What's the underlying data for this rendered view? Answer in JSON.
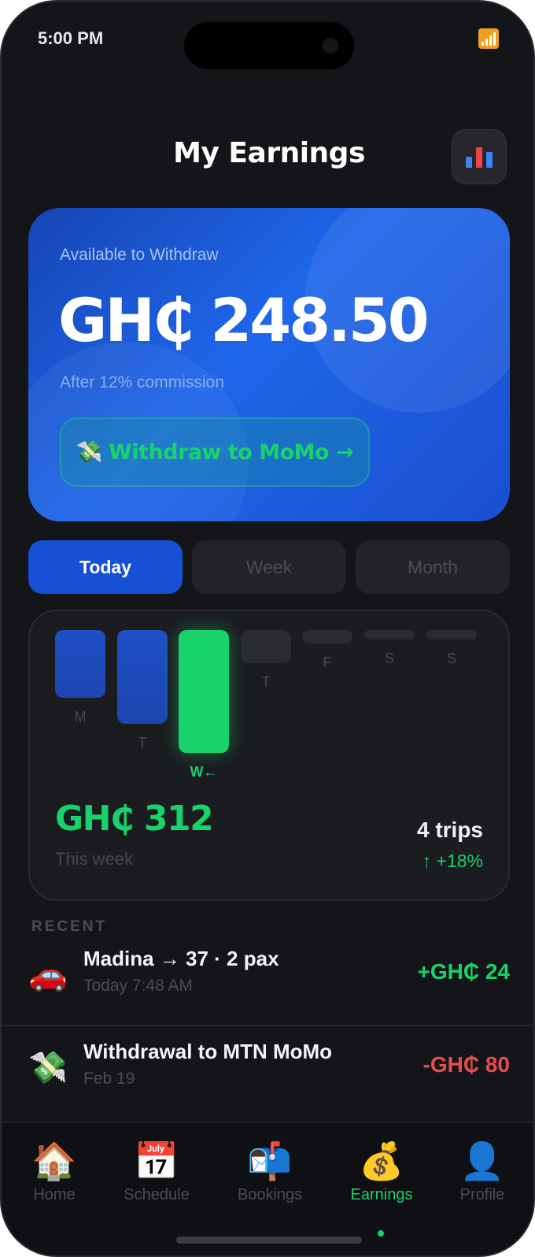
{
  "status_bar": {
    "time": "5:00 PM"
  },
  "header": {
    "title": "My Earnings",
    "stats_icon": "bar-chart-icon"
  },
  "balance": {
    "label": "Available to Withdraw",
    "amount": "GH₵ 248.50",
    "subtext": "After 12% commission",
    "withdraw_icon": "💸",
    "withdraw_label": "Withdraw to MoMo →"
  },
  "tabs": [
    {
      "label": "Today",
      "active": true
    },
    {
      "label": "Week",
      "active": false
    },
    {
      "label": "Month",
      "active": false
    }
  ],
  "chart_data": {
    "type": "bar",
    "categories": [
      "M",
      "T",
      "W←",
      "T",
      "F",
      "S",
      "S"
    ],
    "values": [
      0.55,
      0.76,
      1.0,
      0.27,
      0.11,
      0.06,
      0.06
    ],
    "highlight_index": 2,
    "colors": {
      "default": "#1d46b0",
      "highlight": "#18d36b",
      "future": "#2a2b31"
    }
  },
  "week_summary": {
    "total": "GH₵ 312",
    "caption": "This week",
    "trips": "4 trips",
    "growth": "↑ +18%"
  },
  "recent": {
    "heading": "RECENT",
    "items": [
      {
        "icon": "🚗",
        "title": "Madina → 37 · 2 pax",
        "time": "Today 7:48 AM",
        "amount": "+GH₵ 24",
        "type": "credit"
      },
      {
        "icon": "💸",
        "title": "Withdrawal to MTN MoMo",
        "time": "Feb 19",
        "amount": "-GH₵ 80",
        "type": "debit"
      }
    ]
  },
  "nav": {
    "items": [
      {
        "icon": "🏠",
        "label": "Home",
        "active": false
      },
      {
        "icon": "📅",
        "label": "Schedule",
        "active": false
      },
      {
        "icon": "📬",
        "label": "Bookings",
        "active": false
      },
      {
        "icon": "💰",
        "label": "Earnings",
        "active": true
      },
      {
        "icon": "👤",
        "label": "Profile",
        "active": false
      }
    ]
  },
  "colors": {
    "accent": "#18d36b",
    "primary": "#1650d6",
    "debit": "#e84d4d",
    "background": "#141518"
  }
}
